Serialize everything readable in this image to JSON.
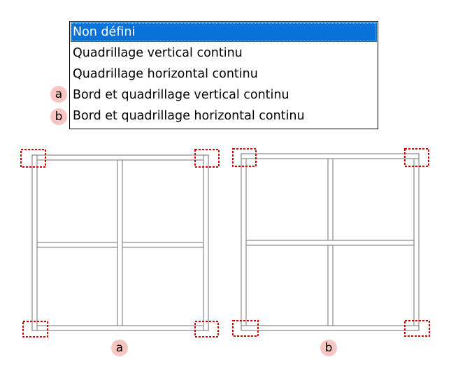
{
  "dropdown": {
    "options": [
      "Non défini",
      "Quadrillage vertical continu",
      "Quadrillage horizontal continu",
      "Bord et quadrillage vertical continu",
      "Bord et quadrillage horizontal continu"
    ],
    "selected_index": 0
  },
  "markers": {
    "a": "a",
    "b": "b"
  },
  "colors": {
    "selection": "#0a71d6",
    "marker_bg": "#f7c6c2",
    "highlight": "#d40000",
    "frame_line": "#8a8a8a"
  }
}
